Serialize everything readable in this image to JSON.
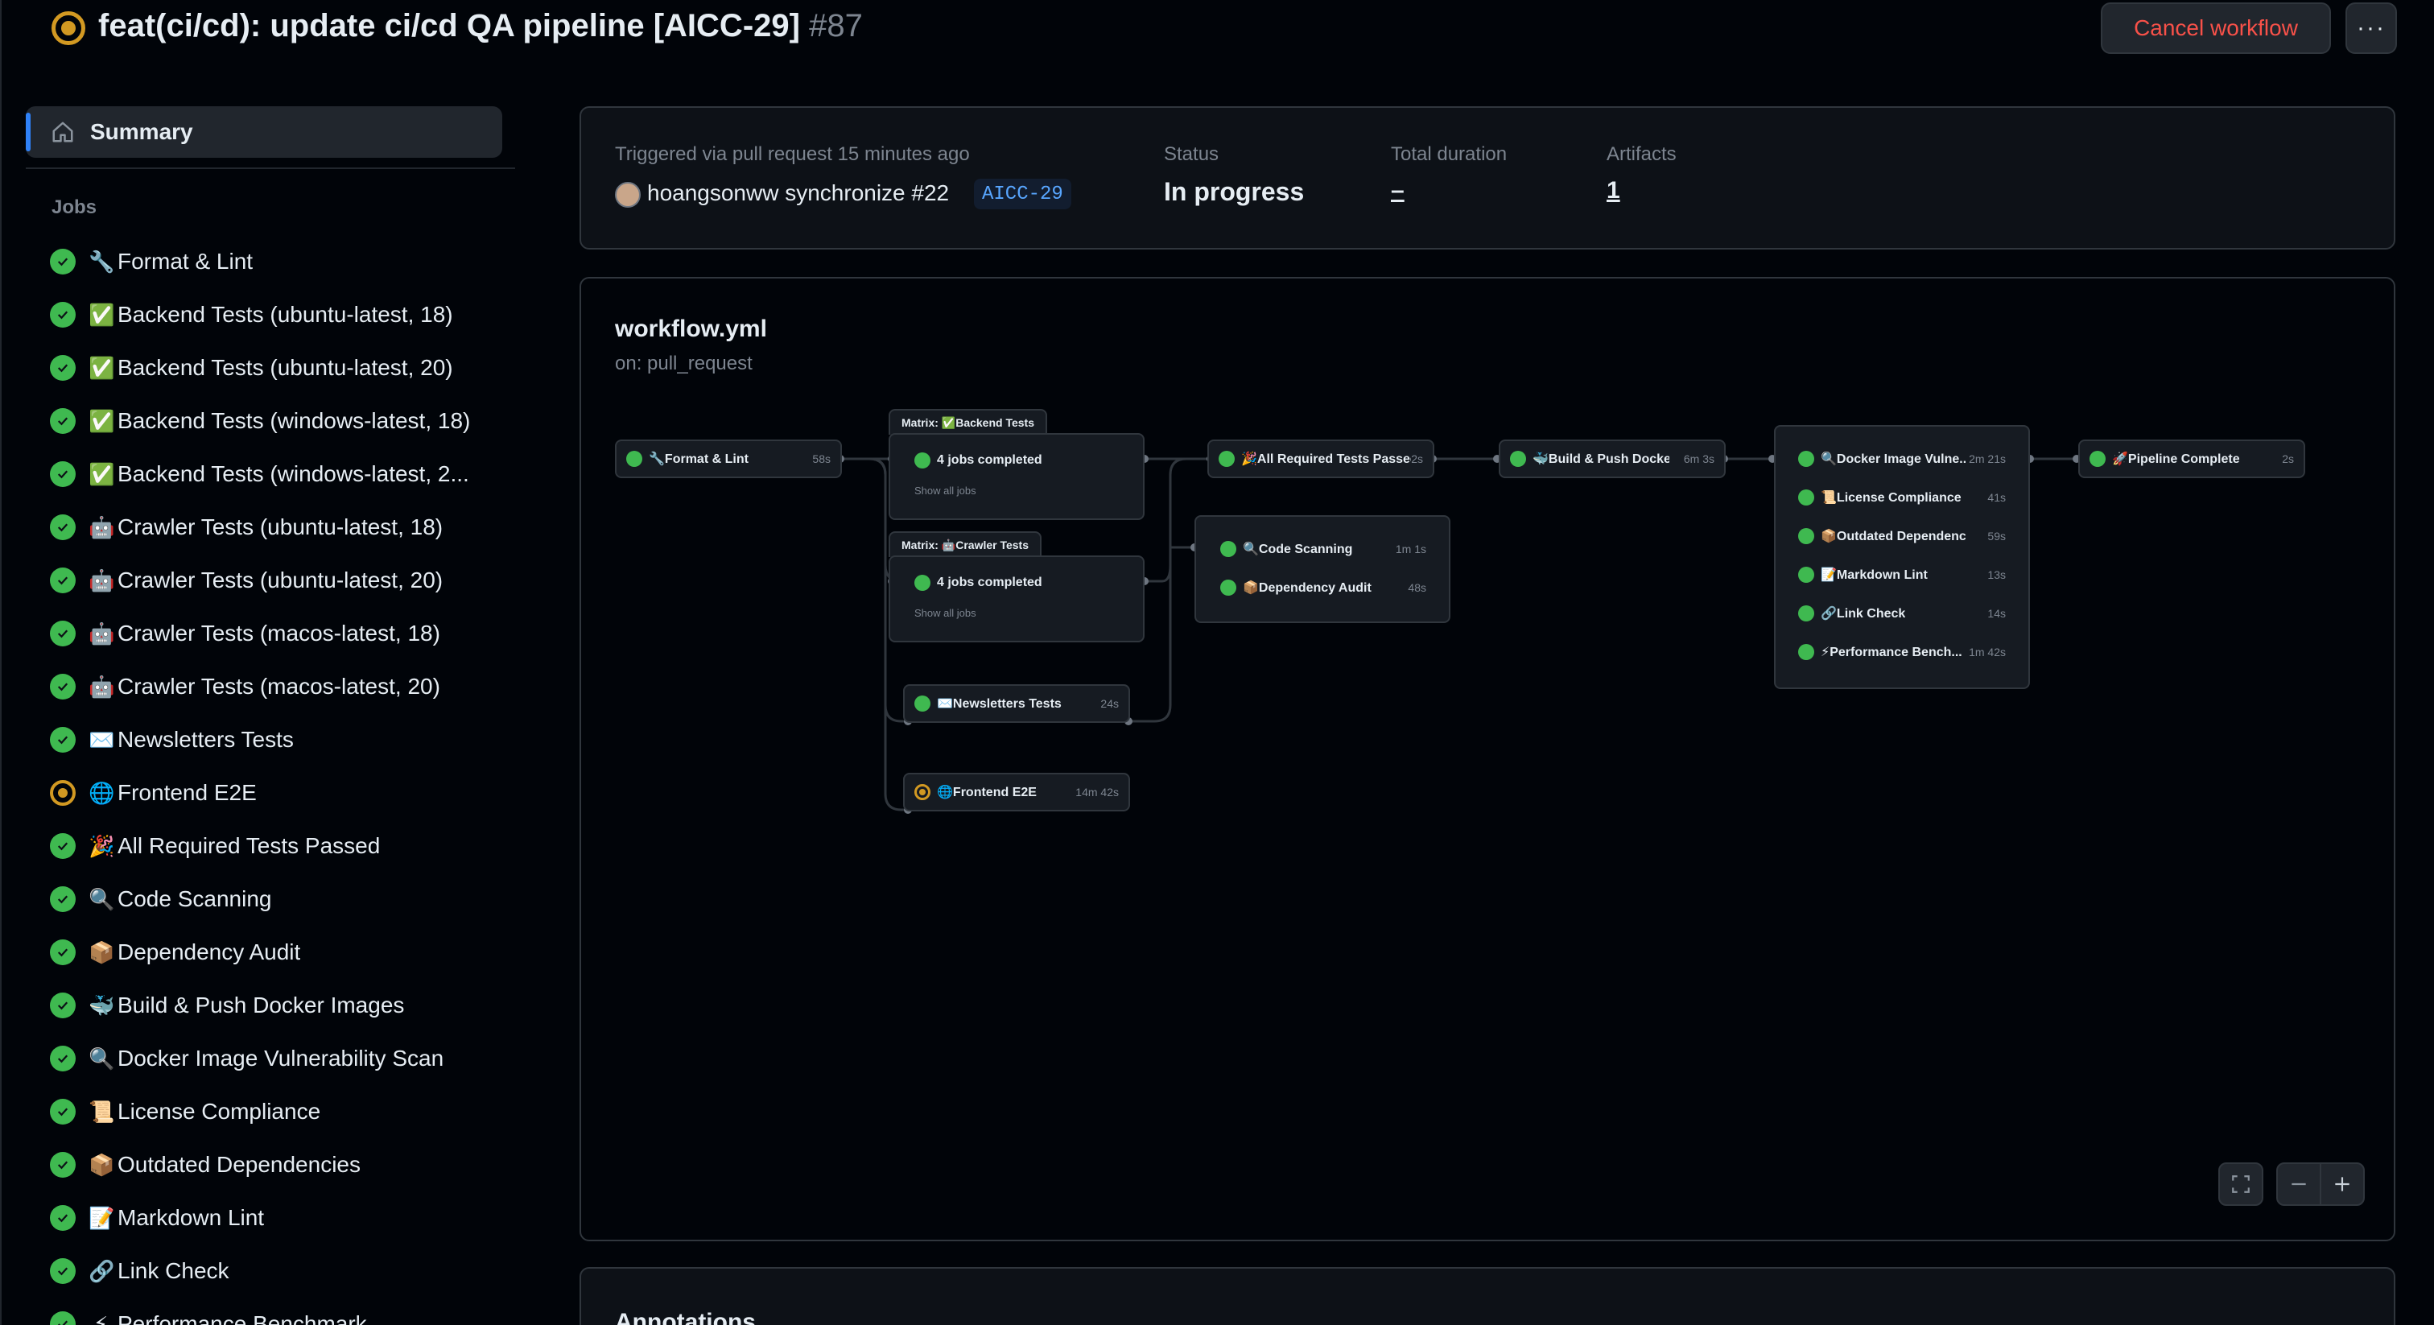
{
  "header": {
    "title": "feat(ci/cd): update ci/cd QA pipeline [AICC-29]",
    "run_number": "#87",
    "cancel_label": "Cancel workflow",
    "more_label": "···"
  },
  "sidebar": {
    "summary_label": "Summary",
    "jobs_heading": "Jobs",
    "jobs": [
      {
        "emoji": "🔧",
        "label": "Format & Lint",
        "status": "success"
      },
      {
        "emoji": "✅",
        "label": "Backend Tests (ubuntu-latest, 18)",
        "status": "success"
      },
      {
        "emoji": "✅",
        "label": "Backend Tests (ubuntu-latest, 20)",
        "status": "success"
      },
      {
        "emoji": "✅",
        "label": "Backend Tests (windows-latest, 18)",
        "status": "success"
      },
      {
        "emoji": "✅",
        "label": "Backend Tests (windows-latest, 2...",
        "status": "success"
      },
      {
        "emoji": "🤖",
        "label": "Crawler Tests (ubuntu-latest, 18)",
        "status": "success"
      },
      {
        "emoji": "🤖",
        "label": "Crawler Tests (ubuntu-latest, 20)",
        "status": "success"
      },
      {
        "emoji": "🤖",
        "label": "Crawler Tests (macos-latest, 18)",
        "status": "success"
      },
      {
        "emoji": "🤖",
        "label": "Crawler Tests (macos-latest, 20)",
        "status": "success"
      },
      {
        "emoji": "✉️",
        "label": "Newsletters Tests",
        "status": "success"
      },
      {
        "emoji": "🌐",
        "label": "Frontend E2E",
        "status": "in_progress"
      },
      {
        "emoji": "🎉",
        "label": "All Required Tests Passed",
        "status": "success"
      },
      {
        "emoji": "🔍",
        "label": "Code Scanning",
        "status": "success"
      },
      {
        "emoji": "📦",
        "label": "Dependency Audit",
        "status": "success"
      },
      {
        "emoji": "🐳",
        "label": "Build & Push Docker Images",
        "status": "success"
      },
      {
        "emoji": "🔍",
        "label": "Docker Image Vulnerability Scan",
        "status": "success"
      },
      {
        "emoji": "📜",
        "label": "License Compliance",
        "status": "success"
      },
      {
        "emoji": "📦",
        "label": "Outdated Dependencies",
        "status": "success"
      },
      {
        "emoji": "📝",
        "label": "Markdown Lint",
        "status": "success"
      },
      {
        "emoji": "🔗",
        "label": "Link Check",
        "status": "success"
      },
      {
        "emoji": "⚡",
        "label": "Performance Benchmark",
        "status": "success"
      }
    ]
  },
  "info": {
    "triggered_label": "Triggered via pull request 15 minutes ago",
    "trigger_text": "hoangsonww synchronize #22",
    "branch": "AICC-29",
    "status_label": "Status",
    "status_value": "In progress",
    "duration_label": "Total duration",
    "duration_value": "–",
    "artifacts_label": "Artifacts",
    "artifacts_value": "1"
  },
  "graph": {
    "file": "workflow.yml",
    "trigger": "on: pull_request",
    "format_lint": {
      "name": "🔧Format & Lint",
      "duration": "58s"
    },
    "matrix_backend": {
      "tab": "Matrix: ✅Backend Tests",
      "summary": "4 jobs completed",
      "show_all": "Show all jobs"
    },
    "matrix_crawler": {
      "tab": "Matrix: 🤖Crawler Tests",
      "summary": "4 jobs completed",
      "show_all": "Show all jobs"
    },
    "newsletters": {
      "name": "✉️Newsletters Tests",
      "duration": "24s"
    },
    "frontend": {
      "name": "🌐Frontend E2E",
      "duration": "14m 42s"
    },
    "all_required": {
      "name": "🎉All Required Tests Passed",
      "duration": "2s"
    },
    "security": [
      {
        "name": "🔍Code Scanning",
        "duration": "1m 1s"
      },
      {
        "name": "📦Dependency Audit",
        "duration": "48s"
      }
    ],
    "build_push": {
      "name": "🐳Build & Push Docker ...",
      "duration": "6m 3s"
    },
    "post_checks": [
      {
        "name": "🔍Docker Image Vulne...",
        "duration": "2m 21s"
      },
      {
        "name": "📜License Compliance",
        "duration": "41s"
      },
      {
        "name": "📦Outdated Dependencies",
        "duration": "59s"
      },
      {
        "name": "📝Markdown Lint",
        "duration": "13s"
      },
      {
        "name": "🔗Link Check",
        "duration": "14s"
      },
      {
        "name": "⚡Performance Bench...",
        "duration": "1m 42s"
      }
    ],
    "pipeline_complete": {
      "name": "🚀Pipeline Complete",
      "duration": "2s"
    }
  },
  "annotations": {
    "title": "Annotations"
  },
  "colors": {
    "success": "#3fb950",
    "in_progress": "#d29922",
    "accent": "#2f81f7",
    "danger": "#f85149"
  },
  "icons": {
    "summary": "home-icon",
    "fullscreen": "fullscreen-icon",
    "zoom_out": "minus-icon",
    "zoom_in": "plus-icon"
  }
}
